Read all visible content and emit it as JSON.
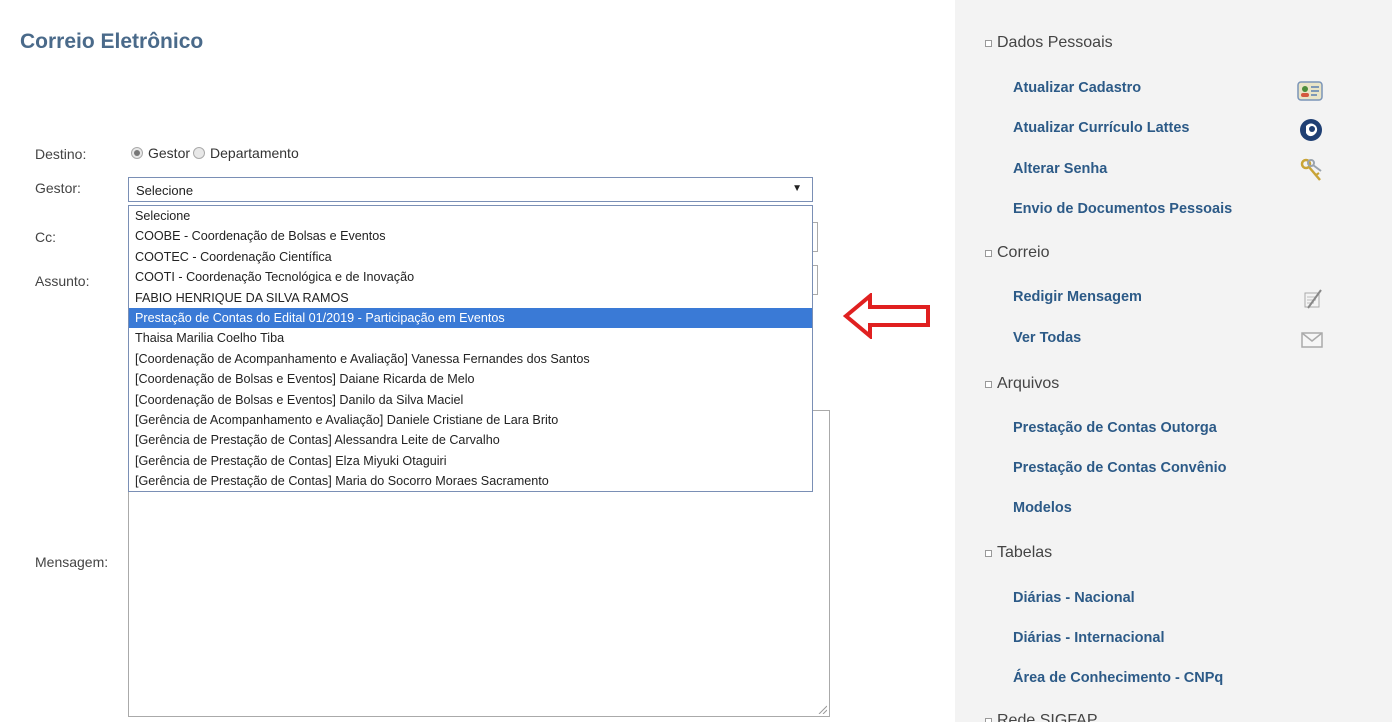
{
  "page": {
    "title": "Correio Eletrônico"
  },
  "form": {
    "destino_label": "Destino:",
    "destino_options": [
      "Gestor",
      "Departamento"
    ],
    "gestor_label": "Gestor:",
    "gestor_selected": "Selecione",
    "cc_label": "Cc:",
    "assunto_label": "Assunto:",
    "mensagem_label": "Mensagem:"
  },
  "dropdown": {
    "options": [
      "Selecione",
      "COOBE - Coordenação de Bolsas e Eventos",
      "COOTEC - Coordenação Científica",
      "COOTI - Coordenação Tecnológica e de Inovação",
      "FABIO HENRIQUE DA SILVA RAMOS",
      "Prestação de Contas do Edital 01/2019 - Participação em Eventos",
      "Thaisa Marilia Coelho Tiba",
      "[Coordenação de Acompanhamento e Avaliação] Vanessa Fernandes dos Santos",
      "[Coordenação de Bolsas e Eventos] Daiane Ricarda de Melo",
      "[Coordenação de Bolsas e Eventos] Danilo da Silva Maciel",
      "[Gerência de Acompanhamento e Avaliação] Daniele Cristiane de Lara Brito",
      "[Gerência de Prestação de Contas] Alessandra Leite de Carvalho",
      "[Gerência de Prestação de Contas] Elza Miyuki Otaguiri",
      "[Gerência de Prestação de Contas] Maria do Socorro Moraes Sacramento"
    ],
    "highlighted_index": 5,
    "highlight_color": "#3a7ad6"
  },
  "annotation": {
    "arrow_color": "#e02020"
  },
  "sidebar": {
    "sections": [
      {
        "title": "Dados Pessoais",
        "items": [
          {
            "label": "Atualizar Cadastro",
            "icon": "id-card-icon"
          },
          {
            "label": "Atualizar Currículo Lattes",
            "icon": "lattes-icon"
          },
          {
            "label": "Alterar Senha",
            "icon": "keys-icon"
          },
          {
            "label": "Envio de Documentos Pessoais"
          }
        ]
      },
      {
        "title": "Correio",
        "items": [
          {
            "label": "Redigir Mensagem",
            "icon": "compose-icon"
          },
          {
            "label": "Ver Todas",
            "icon": "envelope-icon"
          }
        ]
      },
      {
        "title": "Arquivos",
        "items": [
          {
            "label": "Prestação de Contas Outorga"
          },
          {
            "label": "Prestação de Contas Convênio"
          },
          {
            "label": "Modelos"
          }
        ]
      },
      {
        "title": "Tabelas",
        "items": [
          {
            "label": "Diárias - Nacional"
          },
          {
            "label": "Diárias - Internacional"
          },
          {
            "label": "Área de Conhecimento - CNPq"
          }
        ]
      },
      {
        "title": "Rede SIGFAP",
        "items": []
      }
    ],
    "link_color": "#2c5a87"
  }
}
